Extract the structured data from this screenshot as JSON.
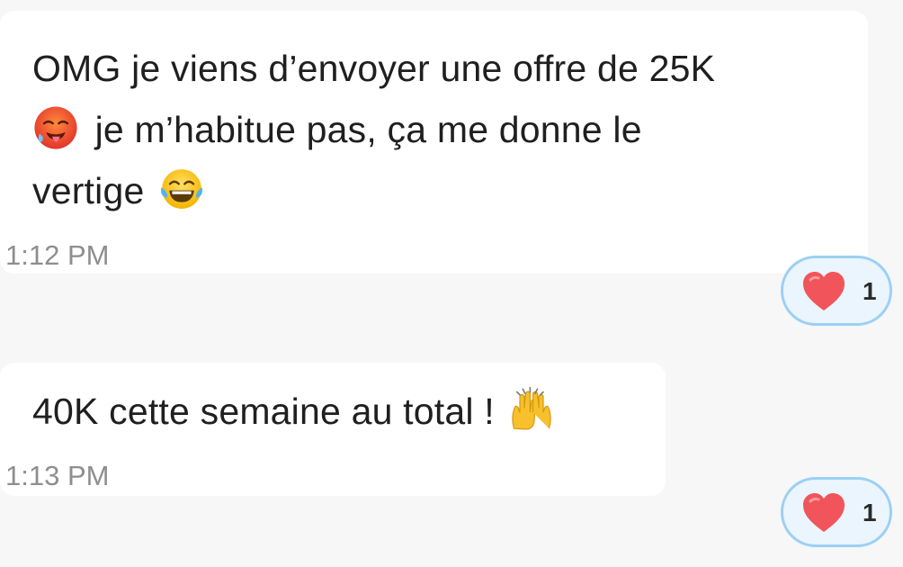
{
  "messages": [
    {
      "lines": [
        [
          {
            "text": "OMG je viens d’envoyer une offre de 25K"
          }
        ],
        [
          {
            "emoji": "hot-face-emoji"
          },
          {
            "text": " je m’habitue pas, ça me donne le"
          }
        ],
        [
          {
            "text": "vertige "
          },
          {
            "emoji": "tears-of-joy-emoji"
          }
        ]
      ],
      "line1": "OMG je viens d’envoyer une offre de 25K",
      "line2": "je m’habitue pas, ça me donne le",
      "line3": "vertige",
      "timestamp": "1:12 PM",
      "reaction": {
        "icon": "heart-icon",
        "count": "1"
      }
    },
    {
      "line1": "40K cette semaine au total !",
      "timestamp": "1:13 PM",
      "reaction": {
        "icon": "heart-icon",
        "count": "1"
      },
      "emoji": "raising-hands-emoji"
    }
  ],
  "colors": {
    "background": "#f7f7f7",
    "bubble": "#ffffff",
    "text": "#1f1f1f",
    "timestamp": "#8e8e8e",
    "reaction_bg": "#eaf5fd",
    "reaction_border": "#9bd0f5",
    "heart": "#f2545b"
  }
}
